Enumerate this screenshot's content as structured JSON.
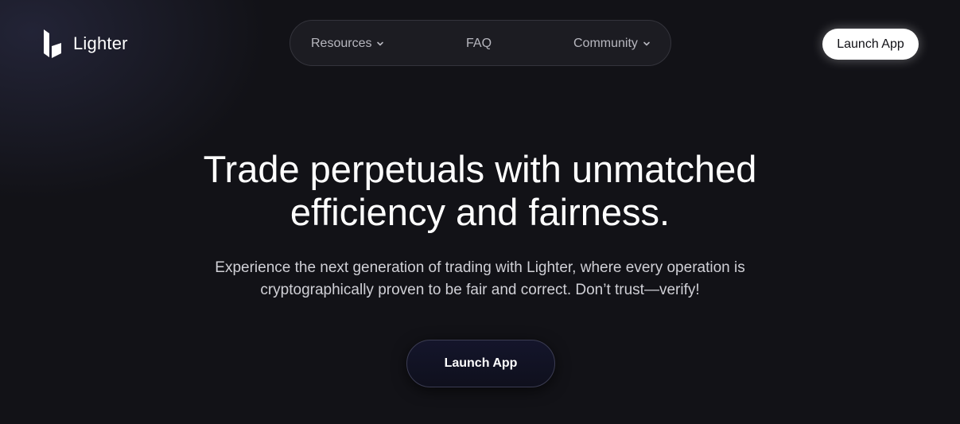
{
  "brand": {
    "name": "Lighter",
    "logo_icon": "lighter-logo-icon"
  },
  "nav": {
    "items": [
      {
        "label": "Resources",
        "icon": "chevron-down-icon"
      },
      {
        "label": "FAQ"
      },
      {
        "label": "Community",
        "icon": "chevron-down-icon"
      }
    ]
  },
  "header": {
    "cta_label": "Launch App"
  },
  "hero": {
    "title_line1": "Trade perpetuals with unmatched",
    "title_line2": "efficiency and fairness.",
    "subtitle_line1": "Experience the next generation of trading with Lighter, where every operation is",
    "subtitle_line2": "cryptographically proven to be fair and correct. Don’t trust—verify!",
    "cta_label": "Launch App"
  },
  "colors": {
    "background": "#121217",
    "nav_background": "#1c1c22",
    "accent_button": "#ffffff"
  }
}
